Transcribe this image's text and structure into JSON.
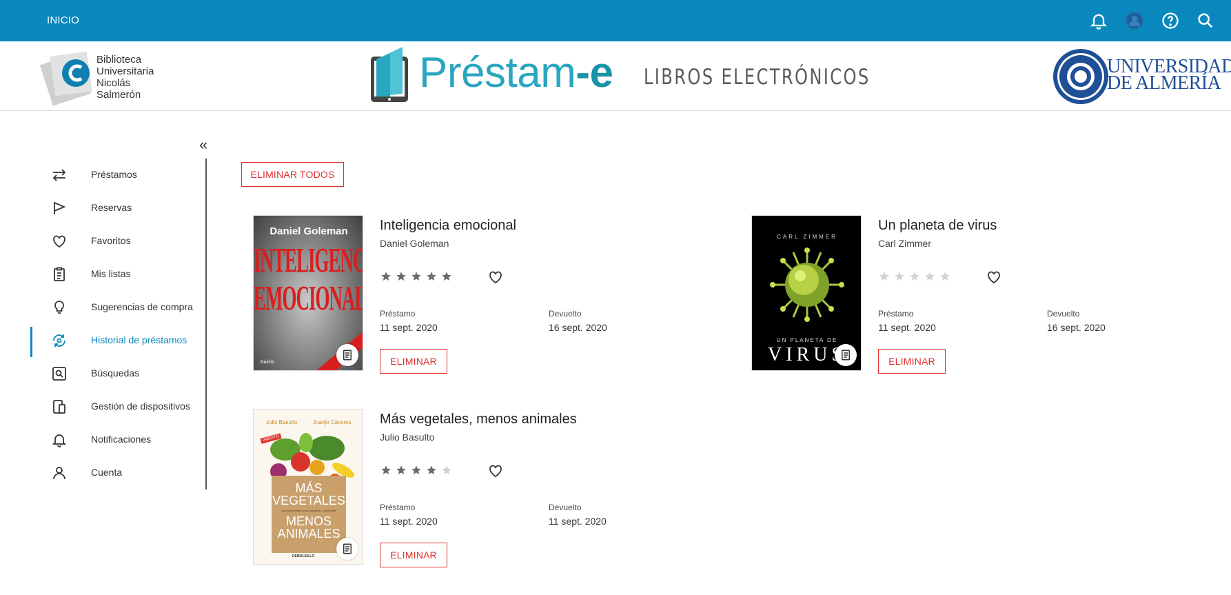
{
  "topbar": {
    "home_label": "INICIO",
    "icons": [
      "bell-icon",
      "user-avatar-icon",
      "help-icon",
      "search-icon"
    ],
    "color": "#0a88bd"
  },
  "header": {
    "library_name": [
      "Biblioteca",
      "Universitaria",
      "Nicolás",
      "Salmerón"
    ],
    "app_title_main": "Préstam",
    "app_title_suffix": "-e",
    "app_subtitle": "LIBROS ELECTRÓNICOS",
    "university_name": [
      "UNIVERSIDAD",
      "DE ALMERÍA"
    ]
  },
  "sidebar": {
    "collapse_label": "«",
    "active_color": "#0a88bd",
    "items": [
      {
        "label": "Préstamos",
        "icon": "swap-arrows-icon"
      },
      {
        "label": "Reservas",
        "icon": "flag-icon"
      },
      {
        "label": "Favoritos",
        "icon": "heart-icon"
      },
      {
        "label": "Mis listas",
        "icon": "clipboard-icon"
      },
      {
        "label": "Sugerencias de compra",
        "icon": "lightbulb-icon"
      },
      {
        "label": "Historial de préstamos",
        "icon": "history-icon",
        "active": true
      },
      {
        "label": "Búsquedas",
        "icon": "search-box-icon"
      },
      {
        "label": "Gestión de dispositivos",
        "icon": "devices-icon"
      },
      {
        "label": "Notificaciones",
        "icon": "bell-icon"
      },
      {
        "label": "Cuenta",
        "icon": "person-icon"
      }
    ]
  },
  "main": {
    "delete_all_label": "ELIMINAR TODOS",
    "accent_color": "#e0302f",
    "loan_label": "Préstamo",
    "returned_label": "Devuelto",
    "delete_label": "ELIMINAR",
    "books": [
      {
        "title": "Inteligencia emocional",
        "author": "Daniel Goleman",
        "rating": 5,
        "loan_date": "11 sept. 2020",
        "returned_date": "16 sept. 2020",
        "cover": {
          "top_text": "Daniel Goleman",
          "line1": "INTELIGENCIA",
          "line2": "EMOCIONAL",
          "publisher": "Kairós"
        }
      },
      {
        "title": "Un planeta de virus",
        "author": "Carl Zimmer",
        "rating": 0,
        "loan_date": "11 sept. 2020",
        "returned_date": "16 sept. 2020",
        "cover": {
          "top_text": "CARL ZIMMER",
          "line1": "UN PLANETA DE",
          "line2": "VIRUS"
        }
      },
      {
        "title": "Más vegetales, menos animales",
        "author": "Julio Basulto",
        "rating": 4,
        "loan_date": "11 sept. 2020",
        "returned_date": "11 sept. 2020",
        "cover": {
          "author1": "Julio Basulto",
          "author2": "Juanjo Cáceres",
          "line1": "MÁS",
          "line2": "VEGETALES",
          "line3": "MENOS",
          "line4": "ANIMALES",
          "tag": "INÉDITO",
          "tagline": "Una alimentación más saludable y sostenible",
          "publisher": "DEBOLSILLO"
        }
      }
    ]
  }
}
